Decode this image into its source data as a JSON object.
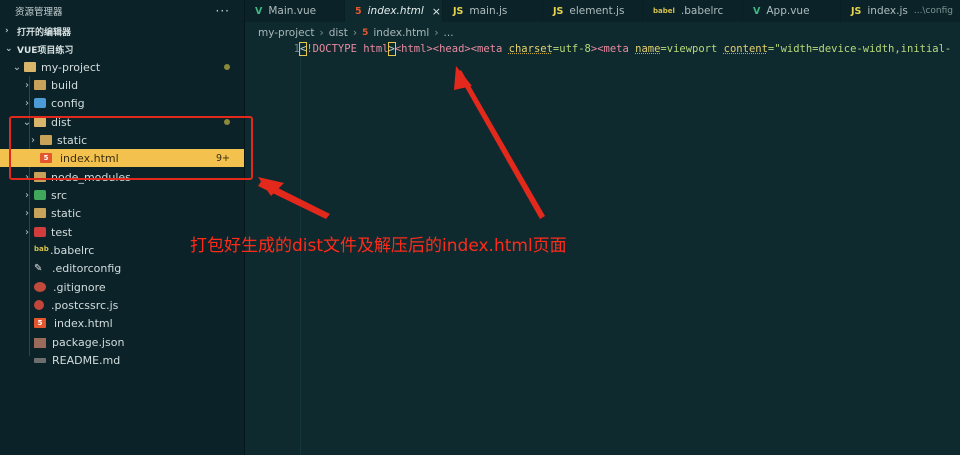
{
  "sidebar": {
    "title": "资源管理器",
    "menu_icon": "ellipsis-icon",
    "sections": {
      "open_editors": "打开的编辑器",
      "workspace": "VUE项目练习"
    },
    "tree": [
      {
        "label": "my-project",
        "icon": "folder-open-icon",
        "chevron": "down"
      },
      {
        "label": "build",
        "icon": "folder-icon",
        "chevron": "right"
      },
      {
        "label": "config",
        "icon": "config-folder-icon",
        "chevron": "right"
      },
      {
        "label": "dist",
        "icon": "folder-open-icon",
        "chevron": "down"
      },
      {
        "label": "static",
        "icon": "folder-icon",
        "chevron": "right"
      },
      {
        "label": "index.html",
        "icon": "html-file-icon",
        "badge": "9+"
      },
      {
        "label": "node_modules",
        "icon": "folder-icon",
        "chevron": "right"
      },
      {
        "label": "src",
        "icon": "src-folder-icon",
        "chevron": "right"
      },
      {
        "label": "static",
        "icon": "folder-icon",
        "chevron": "right"
      },
      {
        "label": "test",
        "icon": "test-folder-icon",
        "chevron": "right"
      },
      {
        "label": ".babelrc",
        "icon": "babel-file-icon"
      },
      {
        "label": ".editorconfig",
        "icon": "editorconfig-file-icon"
      },
      {
        "label": ".gitignore",
        "icon": "git-file-icon"
      },
      {
        "label": ".postcssrc.js",
        "icon": "postcss-file-icon"
      },
      {
        "label": "index.html",
        "icon": "html-file-icon"
      },
      {
        "label": "package.json",
        "icon": "json-file-icon"
      },
      {
        "label": "README.md",
        "icon": "markdown-file-icon"
      }
    ]
  },
  "tabs": [
    {
      "label": "Main.vue",
      "icon": "vue-icon",
      "glyph": "V"
    },
    {
      "label": "index.html",
      "icon": "html-icon",
      "glyph": "5",
      "close": "×"
    },
    {
      "label": "main.js",
      "icon": "js-icon",
      "glyph": "JS"
    },
    {
      "label": "element.js",
      "icon": "js-icon",
      "glyph": "JS"
    },
    {
      "label": ".babelrc",
      "icon": "babel-icon",
      "glyph": "babel"
    },
    {
      "label": "App.vue",
      "icon": "vue-icon",
      "glyph": "V"
    },
    {
      "label": "index.js",
      "icon": "js-icon",
      "glyph": "JS",
      "hint": "...\\config"
    }
  ],
  "breadcrumb": [
    "my-project",
    "dist",
    "index.html",
    "..."
  ],
  "editor": {
    "line_number": "1",
    "code": {
      "p1": "<",
      "doctype": "!DOCTYPE html",
      "p2": ">",
      "html_tag": "<html>",
      "head_tag": "<head>",
      "meta1_open": "<meta",
      "charset_attr": "charset",
      "charset_val": "=utf-8",
      "meta1_close": ">",
      "meta2_open": "<meta",
      "name_attr": "name",
      "name_val": "=viewport",
      "content_attr": "content",
      "content_val": "=\"width=device-width,initial-"
    }
  },
  "annotation": "打包好生成的dist文件及解压后的index.html页面",
  "colors": {
    "annotation": "#ff2a1a",
    "selection": "#f3c24e",
    "background": "#0e2a2f"
  }
}
